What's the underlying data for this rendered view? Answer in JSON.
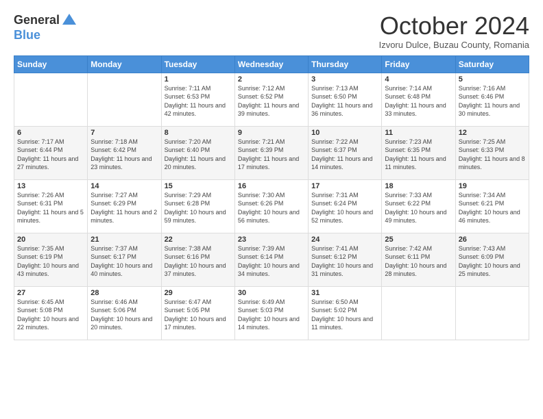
{
  "header": {
    "logo_general": "General",
    "logo_blue": "Blue",
    "month_title": "October 2024",
    "subtitle": "Izvoru Dulce, Buzau County, Romania"
  },
  "days_of_week": [
    "Sunday",
    "Monday",
    "Tuesday",
    "Wednesday",
    "Thursday",
    "Friday",
    "Saturday"
  ],
  "weeks": [
    [
      {
        "day": "",
        "detail": ""
      },
      {
        "day": "",
        "detail": ""
      },
      {
        "day": "1",
        "detail": "Sunrise: 7:11 AM\nSunset: 6:53 PM\nDaylight: 11 hours and 42 minutes."
      },
      {
        "day": "2",
        "detail": "Sunrise: 7:12 AM\nSunset: 6:52 PM\nDaylight: 11 hours and 39 minutes."
      },
      {
        "day": "3",
        "detail": "Sunrise: 7:13 AM\nSunset: 6:50 PM\nDaylight: 11 hours and 36 minutes."
      },
      {
        "day": "4",
        "detail": "Sunrise: 7:14 AM\nSunset: 6:48 PM\nDaylight: 11 hours and 33 minutes."
      },
      {
        "day": "5",
        "detail": "Sunrise: 7:16 AM\nSunset: 6:46 PM\nDaylight: 11 hours and 30 minutes."
      }
    ],
    [
      {
        "day": "6",
        "detail": "Sunrise: 7:17 AM\nSunset: 6:44 PM\nDaylight: 11 hours and 27 minutes."
      },
      {
        "day": "7",
        "detail": "Sunrise: 7:18 AM\nSunset: 6:42 PM\nDaylight: 11 hours and 23 minutes."
      },
      {
        "day": "8",
        "detail": "Sunrise: 7:20 AM\nSunset: 6:40 PM\nDaylight: 11 hours and 20 minutes."
      },
      {
        "day": "9",
        "detail": "Sunrise: 7:21 AM\nSunset: 6:39 PM\nDaylight: 11 hours and 17 minutes."
      },
      {
        "day": "10",
        "detail": "Sunrise: 7:22 AM\nSunset: 6:37 PM\nDaylight: 11 hours and 14 minutes."
      },
      {
        "day": "11",
        "detail": "Sunrise: 7:23 AM\nSunset: 6:35 PM\nDaylight: 11 hours and 11 minutes."
      },
      {
        "day": "12",
        "detail": "Sunrise: 7:25 AM\nSunset: 6:33 PM\nDaylight: 11 hours and 8 minutes."
      }
    ],
    [
      {
        "day": "13",
        "detail": "Sunrise: 7:26 AM\nSunset: 6:31 PM\nDaylight: 11 hours and 5 minutes."
      },
      {
        "day": "14",
        "detail": "Sunrise: 7:27 AM\nSunset: 6:29 PM\nDaylight: 11 hours and 2 minutes."
      },
      {
        "day": "15",
        "detail": "Sunrise: 7:29 AM\nSunset: 6:28 PM\nDaylight: 10 hours and 59 minutes."
      },
      {
        "day": "16",
        "detail": "Sunrise: 7:30 AM\nSunset: 6:26 PM\nDaylight: 10 hours and 56 minutes."
      },
      {
        "day": "17",
        "detail": "Sunrise: 7:31 AM\nSunset: 6:24 PM\nDaylight: 10 hours and 52 minutes."
      },
      {
        "day": "18",
        "detail": "Sunrise: 7:33 AM\nSunset: 6:22 PM\nDaylight: 10 hours and 49 minutes."
      },
      {
        "day": "19",
        "detail": "Sunrise: 7:34 AM\nSunset: 6:21 PM\nDaylight: 10 hours and 46 minutes."
      }
    ],
    [
      {
        "day": "20",
        "detail": "Sunrise: 7:35 AM\nSunset: 6:19 PM\nDaylight: 10 hours and 43 minutes."
      },
      {
        "day": "21",
        "detail": "Sunrise: 7:37 AM\nSunset: 6:17 PM\nDaylight: 10 hours and 40 minutes."
      },
      {
        "day": "22",
        "detail": "Sunrise: 7:38 AM\nSunset: 6:16 PM\nDaylight: 10 hours and 37 minutes."
      },
      {
        "day": "23",
        "detail": "Sunrise: 7:39 AM\nSunset: 6:14 PM\nDaylight: 10 hours and 34 minutes."
      },
      {
        "day": "24",
        "detail": "Sunrise: 7:41 AM\nSunset: 6:12 PM\nDaylight: 10 hours and 31 minutes."
      },
      {
        "day": "25",
        "detail": "Sunrise: 7:42 AM\nSunset: 6:11 PM\nDaylight: 10 hours and 28 minutes."
      },
      {
        "day": "26",
        "detail": "Sunrise: 7:43 AM\nSunset: 6:09 PM\nDaylight: 10 hours and 25 minutes."
      }
    ],
    [
      {
        "day": "27",
        "detail": "Sunrise: 6:45 AM\nSunset: 5:08 PM\nDaylight: 10 hours and 22 minutes."
      },
      {
        "day": "28",
        "detail": "Sunrise: 6:46 AM\nSunset: 5:06 PM\nDaylight: 10 hours and 20 minutes."
      },
      {
        "day": "29",
        "detail": "Sunrise: 6:47 AM\nSunset: 5:05 PM\nDaylight: 10 hours and 17 minutes."
      },
      {
        "day": "30",
        "detail": "Sunrise: 6:49 AM\nSunset: 5:03 PM\nDaylight: 10 hours and 14 minutes."
      },
      {
        "day": "31",
        "detail": "Sunrise: 6:50 AM\nSunset: 5:02 PM\nDaylight: 10 hours and 11 minutes."
      },
      {
        "day": "",
        "detail": ""
      },
      {
        "day": "",
        "detail": ""
      }
    ]
  ]
}
